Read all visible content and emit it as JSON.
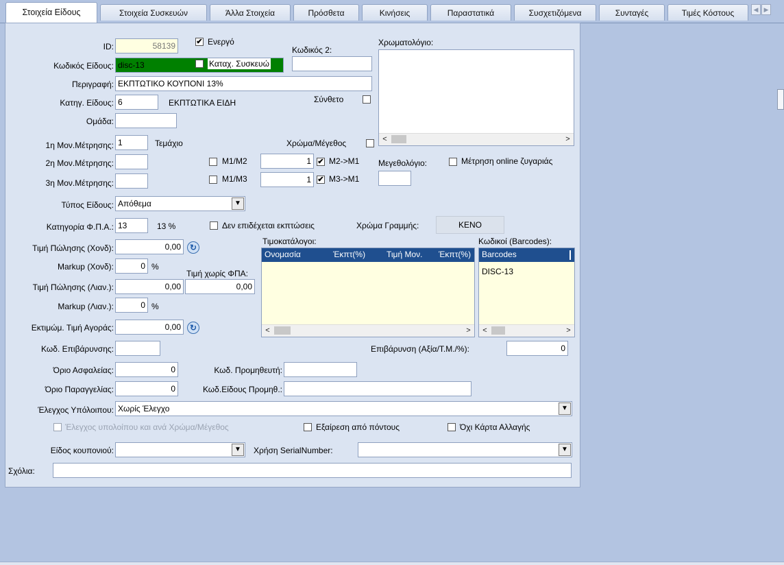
{
  "tabs": [
    "Στοιχεία Είδους",
    "Στοιχεία Συσκευών",
    "Άλλα Στοιχεία",
    "Πρόσθετα",
    "Κινήσεις",
    "Παραστατικά",
    "Συσχετιζόμενα",
    "Συνταγές",
    "Τιμές Κόστους"
  ],
  "form": {
    "id_label": "ID:",
    "id_value": "58139",
    "active_label": "Ενεργό",
    "code2_label": "Κωδικός 2:",
    "code2_value": "",
    "item_code_label": "Κωδικός Είδους:",
    "item_code_value": "disc-13",
    "device_entry_label": "Καταχ. Συσκευώ",
    "description_label": "Περιγραφή:",
    "description_value": "ΕΚΠΤΩΤΙΚΟ ΚΟΥΠΟΝΙ 13%",
    "category_label": "Κατηγ. Είδους:",
    "category_value": "6",
    "category_name": "ΕΚΠΤΩΤΙΚΑ ΕΙΔΗ",
    "composite_label": "Σύνθετο",
    "group_label": "Ομάδα:",
    "group_value": "",
    "uom1_label": "1η Μον.Μέτρησης:",
    "uom1_value": "1",
    "uom1_name": "Τεμάχιο",
    "uom2_label": "2η Μον.Μέτρησης:",
    "uom3_label": "3η Μον.Μέτρησης:",
    "color_size_label": "Χρώμα/Μέγεθος",
    "m1m2_label": "Μ1/Μ2",
    "m1m2_value": "1",
    "m2m1_label": "Μ2->Μ1",
    "m1m3_label": "Μ1/Μ3",
    "m1m3_value": "1",
    "m3m1_label": "Μ3->Μ1",
    "color_catalog_label": "Χρωματολόγιο:",
    "size_catalog_label": "Μεγεθολόγιο:",
    "online_scale_label": "Μέτρηση online ζυγαριάς",
    "item_type_label": "Τύπος Είδους:",
    "item_type_value": "Απόθεμα",
    "vat_category_label": "Κατηγορία Φ.Π.Α.:",
    "vat_category_value": "13",
    "vat_percent": "13 %",
    "no_discounts_label": "Δεν επιδέχεται εκπτώσεις",
    "line_color_label": "Χρώμα Γραμμής:",
    "line_color_value": "ΚΕΝΟ",
    "wholesale_price_label": "Τιμή Πώλησης (Χονδ):",
    "wholesale_price_value": "0,00",
    "markup_wholesale_label": "Markup (Χονδ):",
    "markup_wholesale_value": "0",
    "percent_sign": "%",
    "price_no_vat_label": "Τιμή χωρίς ΦΠΑ:",
    "price_no_vat_value": "0,00",
    "retail_price_label": "Τιμή Πώλησης (Λιαν.):",
    "retail_price_value": "0,00",
    "markup_retail_label": "Markup (Λιαν.):",
    "markup_retail_value": "0",
    "est_purchase_label": "Εκτιμώμ. Τιμή Αγοράς:",
    "est_purchase_value": "0,00",
    "surcharge_code_label": "Κωδ. Επιβάρυνσης:",
    "surcharge_code_value": "",
    "surcharge_label": "Επιβάρυνση (Αξία/Τ.Μ./%):",
    "surcharge_value": "0",
    "safety_limit_label": "Όριο Ασφαλείας:",
    "safety_limit_value": "0",
    "supplier_code_label": "Κωδ. Προμηθευτή:",
    "supplier_code_value": "",
    "order_limit_label": "Όριο Παραγγελίας:",
    "order_limit_value": "0",
    "supplier_item_code_label": "Κωδ.Είδους Προμηθ.:",
    "supplier_item_code_value": "",
    "balance_check_label": "Έλεγχος Υπόλοιπου:",
    "balance_check_value": "Χωρίς Έλεγχο",
    "balance_by_color_label": "Έλεγχος υπολοίπου και ανά Χρώμα/Μέγεθος",
    "exclude_points_label": "Εξαίρεση από πόντους",
    "no_change_card_label": "Όχι Κάρτα Αλλαγής",
    "coupon_type_label": "Είδος κουπονιού:",
    "coupon_type_value": "",
    "serial_usage_label": "Χρήση SerialNumber:",
    "serial_usage_value": "",
    "comments_label": "Σχόλια:",
    "comments_value": ""
  },
  "checkboxes": {
    "active": true,
    "device_entry": false,
    "composite": false,
    "color_size": false,
    "m1m2": false,
    "m2m1": true,
    "m1m3": false,
    "m3m1": true,
    "online_scale": false,
    "no_discounts": false,
    "balance_by_color": false,
    "exclude_points": false,
    "no_change_card": false
  },
  "price_lists": {
    "label": "Τιμοκατάλογοι:",
    "columns": [
      "Ονομασία",
      "Έκπτ(%)",
      "Τιμή Μον.",
      "Έκπτ(%)"
    ]
  },
  "barcodes": {
    "label": "Κωδικοί (Barcodes):",
    "columns": [
      "Barcodes"
    ],
    "rows": [
      "DISC-13"
    ]
  },
  "colors": {
    "background": "#b3c4e1",
    "panel": "#dbe4f2",
    "item_code_bg": "#008000",
    "grid_header": "#1f4f8f",
    "grid_body": "#ffffe1",
    "id_bg": "#ffffe1"
  },
  "icons": {
    "refresh": "refresh-icon",
    "dropdown": "chevron-down-icon",
    "scroll_left": "chevron-left-icon",
    "scroll_right": "chevron-right-icon"
  }
}
